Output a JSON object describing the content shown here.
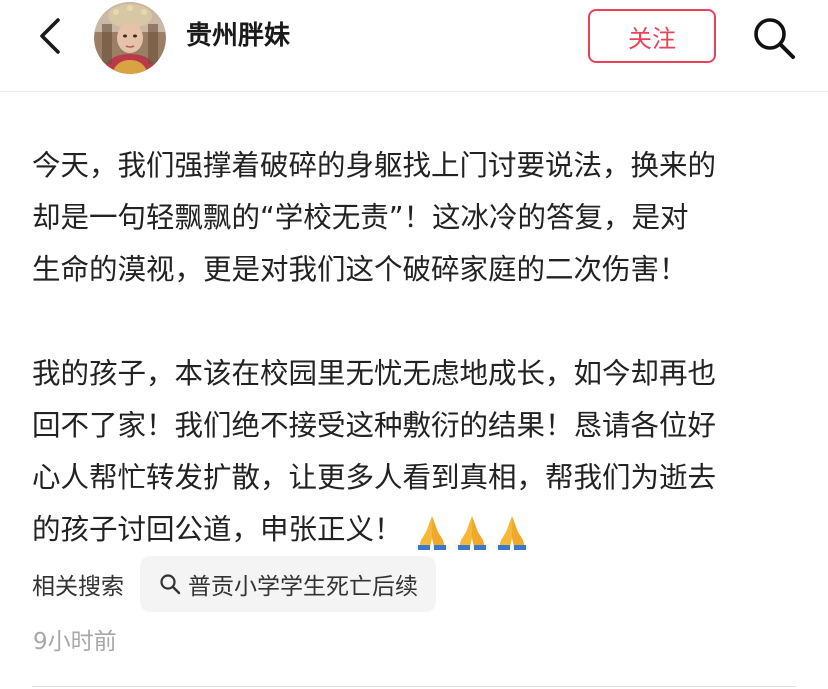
{
  "header": {
    "back_icon": "chevron-left-icon",
    "username": "贵州胖妹",
    "follow_label": "关注",
    "search_icon": "search-icon",
    "accent_color": "#e9435a"
  },
  "post": {
    "paragraph1": "今天，我们强撑着破碎的身躯找上门讨要说法，换来的\n却是一句轻飘飘的“学校无责”！这冰冷的答复，是对\n生命的漠视，更是对我们这个破碎家庭的二次伤害！",
    "paragraph2": "我的孩子，本该在校园里无忧无虑地成长，如今却再也\n回不了家！我们绝不接受这种敷衍的结果！恳请各位好\n心人帮忙转发扩散，让更多人看到真相，帮我们为逝去\n的孩子讨回公道，申张正义！",
    "emoji": [
      "folded-hands",
      "folded-hands",
      "folded-hands"
    ]
  },
  "related": {
    "label": "相关搜索",
    "query": "普贡小学学生死亡后续"
  },
  "meta": {
    "timestamp": "9小时前"
  }
}
